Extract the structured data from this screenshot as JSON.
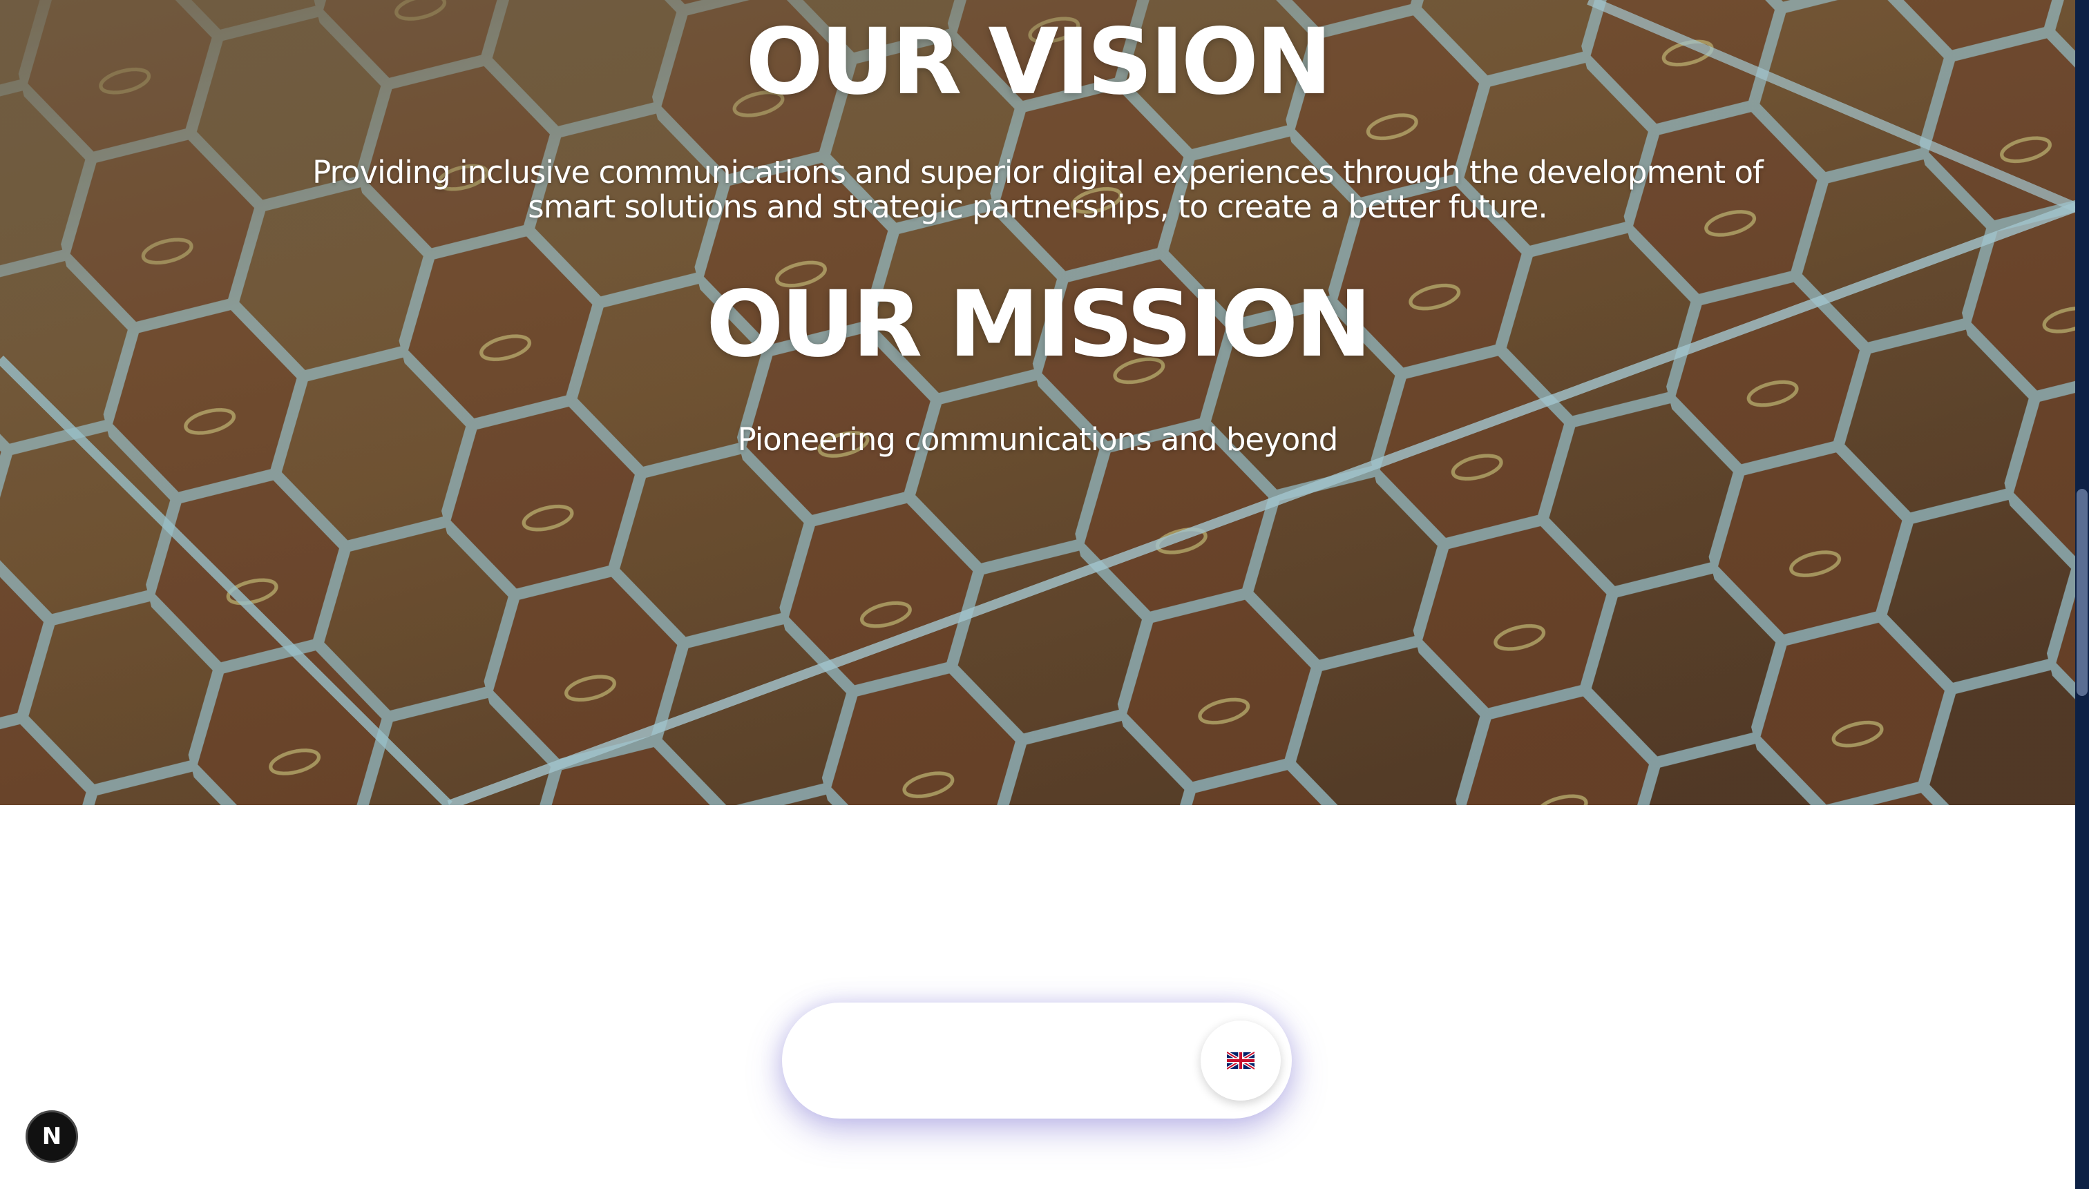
{
  "colors": {
    "scrollbar_track": "#0d2145",
    "scrollbar_thumb": "#5a6e93",
    "hero_text": "#ffffff",
    "hex_grid_lines": "#9fd0dc",
    "pill_shadow": "#6e66d0"
  },
  "hero": {
    "vision_title": "OUR VISION",
    "vision_text": "Providing inclusive communications and superior digital experiences through the development of smart solutions and strategic partnerships, to create a better future.",
    "mission_title": "OUR MISSION",
    "mission_text": "Pioneering communications and beyond",
    "background_image": "aerial-hexagon-grid-field"
  },
  "language_selector": {
    "icon": "uk-flag-icon"
  },
  "dev_badge": {
    "icon": "nextjs-logo-icon",
    "label": "N"
  }
}
